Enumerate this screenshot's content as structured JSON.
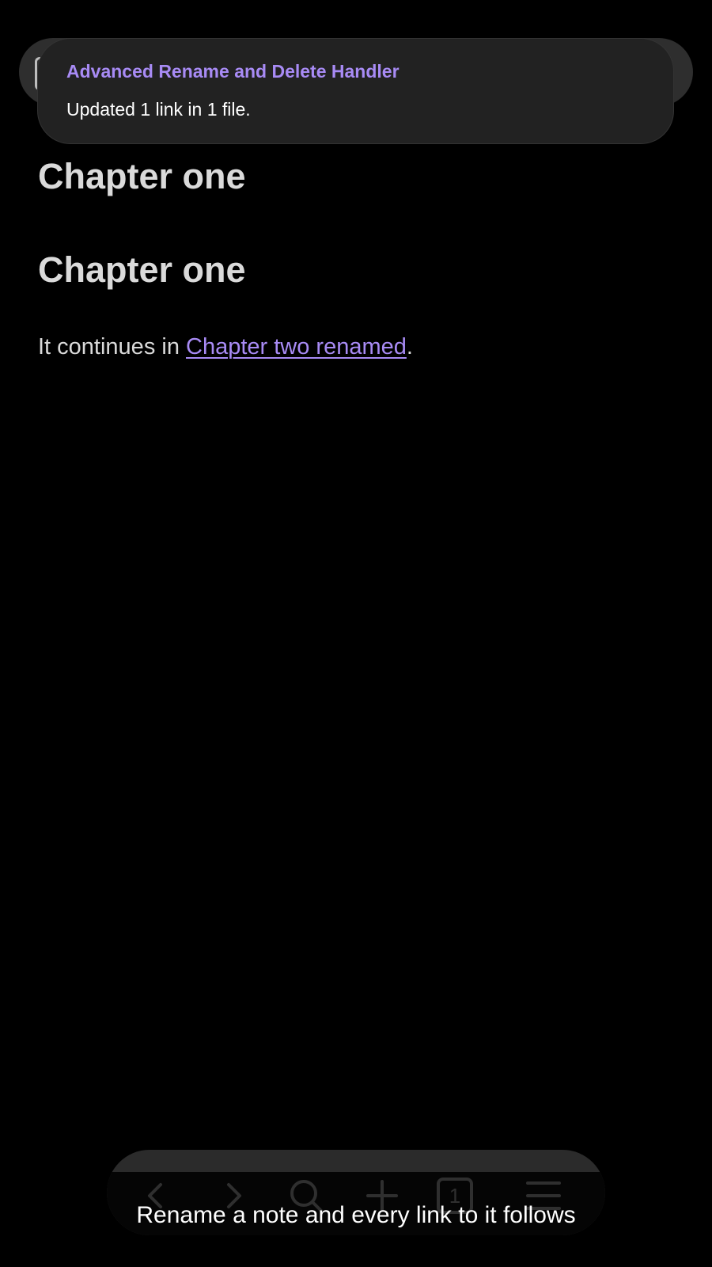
{
  "notice": {
    "title": "Advanced Rename and Delete Handler",
    "message": "Updated 1 link in 1 file."
  },
  "note": {
    "heading_1": "Chapter one",
    "heading_2": "Chapter one",
    "paragraph_prefix": "It continues in ",
    "link_text": "Chapter two renamed",
    "paragraph_suffix": "."
  },
  "bottom_nav": {
    "items": [
      {
        "icon": "back-arrow-icon"
      },
      {
        "icon": "forward-arrow-icon"
      },
      {
        "icon": "search-icon"
      },
      {
        "icon": "plus-icon"
      },
      {
        "icon": "tabs-icon",
        "count": "1"
      },
      {
        "icon": "menu-icon"
      }
    ]
  },
  "caption": "Rename a note and every link to it follows",
  "colors": {
    "background": "#000000",
    "accent": "#a88bf5",
    "text": "#dadada",
    "notice_bg": "#222222"
  }
}
